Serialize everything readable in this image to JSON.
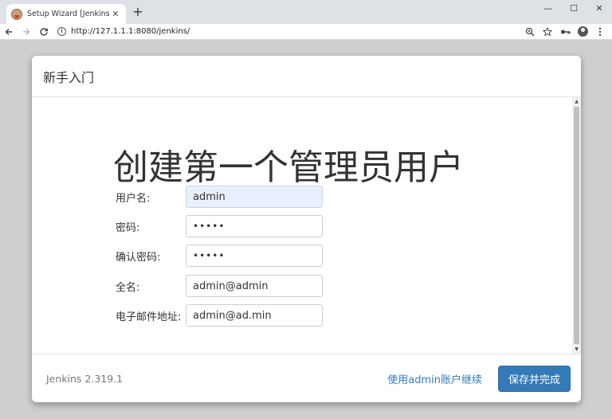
{
  "browser": {
    "tab_title": "Setup Wizard [Jenkins]",
    "tab_close": "✕",
    "new_tab": "+",
    "url": "http://127.1.1.1:8080/jenkins/",
    "window_controls": {
      "minimize": "—",
      "maximize": "☐",
      "close": "✕"
    }
  },
  "dialog": {
    "header_title": "新手入门",
    "heading": "创建第一个管理员用户",
    "fields": [
      {
        "label": "用户名:",
        "value": "admin"
      },
      {
        "label": "密码:",
        "value": "•••••"
      },
      {
        "label": "确认密码:",
        "value": "•••••"
      },
      {
        "label": "全名:",
        "value": "admin@admin"
      },
      {
        "label": "电子邮件地址:",
        "value": "admin@ad.min"
      }
    ],
    "footer": {
      "version": "Jenkins 2.319.1",
      "continue_as_admin": "使用admin账户继续",
      "save_finish": "保存并完成"
    }
  },
  "colors": {
    "primary": "#337ab7",
    "autofill": "#e8f0fe",
    "backdrop": "#cfcfcf"
  }
}
